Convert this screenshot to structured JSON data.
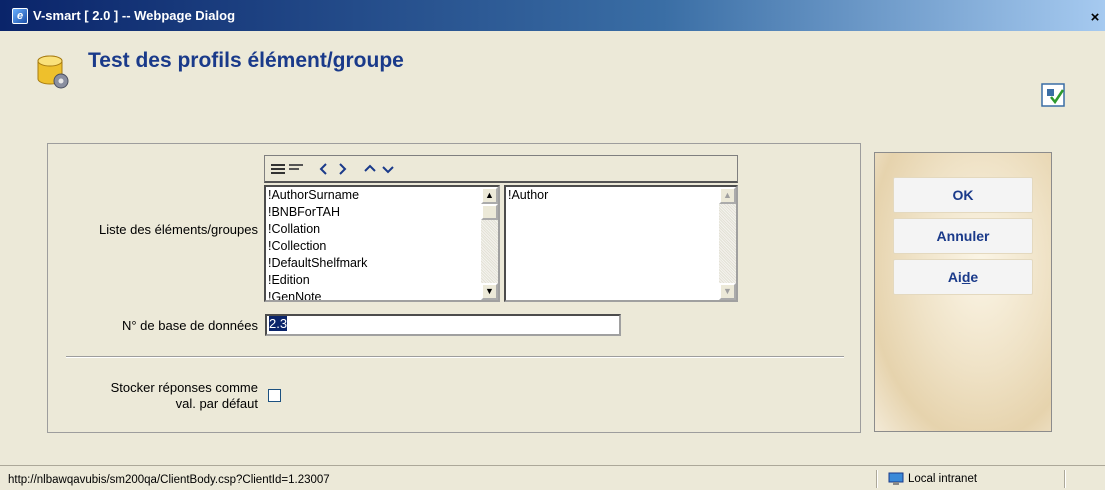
{
  "window": {
    "title": "V-smart [ 2.0 ] -- Webpage Dialog",
    "close_glyph": "×"
  },
  "page": {
    "title": "Test des profils élément/groupe"
  },
  "form": {
    "list_label": "Liste des éléments/groupes",
    "available_items": [
      "!AuthorSurname",
      "!BNBForTAH",
      "!Collation",
      "!Collection",
      "!DefaultShelfmark",
      "!Edition",
      "!GenNote"
    ],
    "selected_items": [
      "!Author"
    ],
    "db_label": "N° de base de données",
    "db_value": "2.3",
    "store_label_line1": "Stocker réponses comme",
    "store_label_line2": "val. par défaut",
    "store_checked": false
  },
  "toolbar": {
    "icons": [
      "align-left-icon",
      "align-right-icon",
      "move-left-icon",
      "move-right-icon",
      "move-up-icon",
      "move-down-icon"
    ]
  },
  "buttons": {
    "ok": "OK",
    "cancel": "Annuler",
    "help_prefix": "Ai",
    "help_underline": "d",
    "help_suffix": "e"
  },
  "statusbar": {
    "url": "http://nlbawqavubis/sm200qa/ClientBody.csp?ClientId=1.23007",
    "zone": "Local intranet"
  },
  "colors": {
    "title_blue": "#1a3a8a",
    "titlebar_dark": "#0a246a",
    "background": "#ece9d8"
  }
}
